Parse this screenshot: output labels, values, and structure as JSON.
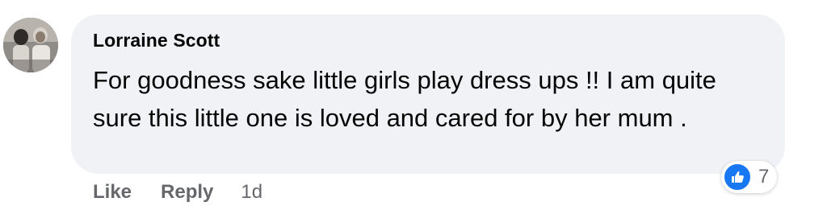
{
  "comment": {
    "author": "Lorraine Scott",
    "text": "For goodness sake little girls play dress ups !! I am quite sure this little one is loved and cared for by her mum .",
    "actions": {
      "like": "Like",
      "reply": "Reply",
      "timestamp": "1d"
    },
    "reactions": {
      "icon": "thumbs-up-icon",
      "count": "7",
      "color": "#1877f2"
    }
  },
  "colors": {
    "bubble": "#f0f2f5",
    "text": "#050505",
    "secondary": "#65676b"
  }
}
